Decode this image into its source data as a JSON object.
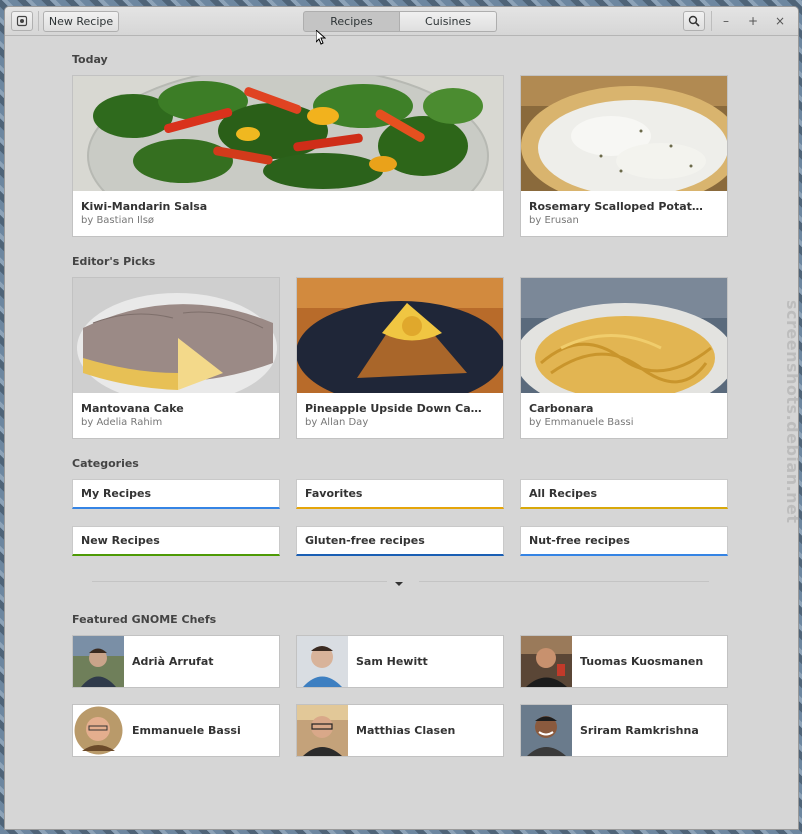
{
  "window": {
    "menu_icon": "window-menu-icon",
    "new_recipe_label": "New Recipe",
    "tabs": [
      {
        "label": "Recipes",
        "active": true
      },
      {
        "label": "Cuisines",
        "active": false
      }
    ],
    "search_icon": "search-icon",
    "controls": {
      "minimize": "–",
      "maximize": "+",
      "close": "×"
    }
  },
  "today": {
    "title": "Today",
    "items": [
      {
        "name": "Kiwi-Mandarin Salsa",
        "author": "by Bastian Ilsø"
      },
      {
        "name": "Rosemary Scalloped Potat…",
        "author": "by Erusan"
      }
    ]
  },
  "editors_picks": {
    "title": "Editor's Picks",
    "items": [
      {
        "name": "Mantovana Cake",
        "author": "by Adelia Rahim"
      },
      {
        "name": "Pineapple Upside Down Ca…",
        "author": "by Allan Day"
      },
      {
        "name": "Carbonara",
        "author": "by Emmanuele Bassi"
      }
    ]
  },
  "categories": {
    "title": "Categories",
    "items": [
      {
        "label": "My Recipes",
        "color": "#3584e4"
      },
      {
        "label": "Favorites",
        "color": "#e5a50a"
      },
      {
        "label": "All Recipes",
        "color": "#d8a80a"
      },
      {
        "label": "New Recipes",
        "color": "#4e9a06"
      },
      {
        "label": "Gluten-free recipes",
        "color": "#1a5fb4"
      },
      {
        "label": "Nut-free recipes",
        "color": "#3584e4"
      }
    ],
    "expand_icon": "expand-arrow-icon"
  },
  "chefs": {
    "title": "Featured GNOME Chefs",
    "items": [
      {
        "name": "Adrià Arrufat"
      },
      {
        "name": "Sam Hewitt"
      },
      {
        "name": "Tuomas Kuosmanen"
      },
      {
        "name": "Emmanuele Bassi"
      },
      {
        "name": "Matthias Clasen"
      },
      {
        "name": "Sriram Ramkrishna"
      }
    ]
  },
  "watermark": "screenshots.debian.net"
}
